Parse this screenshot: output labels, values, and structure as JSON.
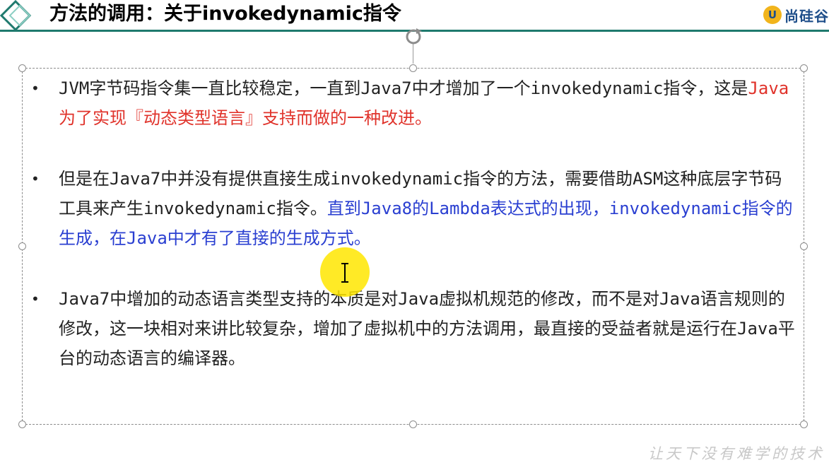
{
  "header": {
    "title": "方法的调用：关于invokedynamic指令",
    "brand_mark": "U",
    "brand_text": "尚硅谷",
    "accent_color": "#1f7a6e",
    "brand_color": "#1f4f8a"
  },
  "bullets": [
    {
      "marker": "•",
      "segments": [
        {
          "text": "JVM字节码指令集一直比较稳定，一直到Java7中才增加了一个invokedynamic指令，这是",
          "color": "#222222"
        },
        {
          "text": "Java为了实现『动态类型语言』支持而做的一种改进。",
          "color": "#e0332b"
        }
      ]
    },
    {
      "marker": "•",
      "segments": [
        {
          "text": "但是在Java7中并没有提供直接生成invokedynamic指令的方法，需要借助ASM这种底层字节码工具来产生invokedynamic指令。",
          "color": "#222222"
        },
        {
          "text": "直到Java8的Lambda表达式的出现，invokedynamic指令的生成，在Java中才有了直接的生成方式。",
          "color": "#2a3fd1"
        }
      ]
    },
    {
      "marker": "•",
      "segments": [
        {
          "text": "Java7中增加的动态语言类型支持的本质是对Java虚拟机规范的修改，而不是对Java语言规则的修改，这一块相对来讲比较复杂，增加了虚拟机中的方法调用，最直接的受益者就是运行在Java平台的动态语言的编译器。",
          "color": "#222222"
        }
      ]
    }
  ],
  "icons": {
    "logo": "diamond-logo-icon",
    "rotate": "rotate-handle-icon",
    "cursor": "text-cursor-icon"
  },
  "watermark": "让天下没有难学的技术"
}
